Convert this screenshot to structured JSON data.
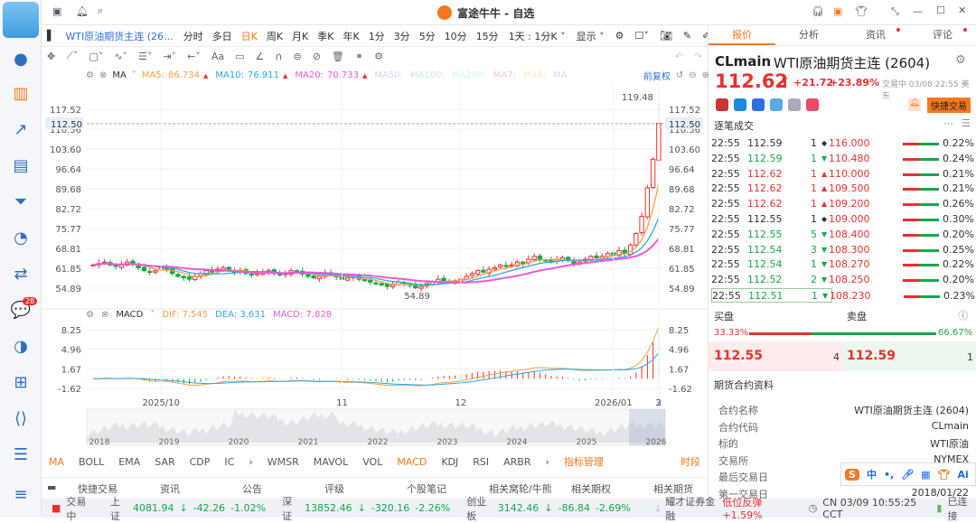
{
  "app": {
    "title": "富途牛牛 - 自选",
    "notification_badge": "28"
  },
  "toolbar": {
    "symbol": "WTI原油期货主连 (26...",
    "periods": [
      "分时",
      "多日",
      "日K",
      "周K",
      "月K",
      "季K",
      "年K",
      "1分",
      "3分",
      "5分",
      "10分",
      "15分"
    ],
    "active_period": "日K",
    "dropdown_15": "15分",
    "range": "1天 : 1分K",
    "display": "显示"
  },
  "ma": {
    "label": "MA",
    "items": [
      {
        "name": "MA5:",
        "value": "86.734",
        "color": "#f5a04a"
      },
      {
        "name": "MA10:",
        "value": "76.911",
        "color": "#2aa8e8"
      },
      {
        "name": "MA20:",
        "value": "70.733",
        "color": "#e85ad8"
      },
      {
        "name": "MA50:",
        "value": "",
        "color": "#c8d8f8"
      },
      {
        "name": "MA100:",
        "value": "",
        "color": "#c8ecd8"
      },
      {
        "name": "MA200:",
        "value": "",
        "color": "#c8f4f8"
      },
      {
        "name": "MA7:",
        "value": "",
        "color": "#f8c8c8"
      },
      {
        "name": "MA8:",
        "value": "",
        "color": "#f8e8c8"
      },
      {
        "name": "MA",
        "value": "",
        "color": "#e0d0f8"
      }
    ],
    "adjust": "前复权"
  },
  "macd": {
    "label": "MACD",
    "dif": "DIF: 7.545",
    "dea": "DEA: 3.631",
    "macd": "MACD: 7.828"
  },
  "chart_data": {
    "type": "candlestick",
    "price_ticks": [
      "117.52",
      "110.56",
      "103.60",
      "96.64",
      "89.68",
      "82.72",
      "75.77",
      "68.81",
      "61.85",
      "54.89"
    ],
    "last_price_label": "112.50",
    "high_label": "119.48",
    "low_label": "54.89",
    "macd_ticks": [
      "8.25",
      "4.96",
      "1.67",
      "-1.62"
    ],
    "x_labels": [
      "2025/10",
      "11",
      "12",
      "2026/01",
      "2",
      "3"
    ],
    "overview_years": [
      "2018",
      "2019",
      "2020",
      "2021",
      "2022",
      "2023",
      "2024",
      "2025",
      "2026"
    ],
    "closes": [
      63,
      63.5,
      64,
      63,
      62.5,
      63,
      64,
      63.5,
      62,
      61,
      60.5,
      61,
      62,
      61.5,
      60,
      59,
      58.5,
      58,
      59,
      60,
      61,
      60.5,
      61.5,
      62,
      61,
      60.5,
      61,
      60,
      59.5,
      60,
      60.5,
      61,
      60,
      59.5,
      60,
      61,
      60.5,
      59.8,
      59,
      58.5,
      59,
      60,
      59.5,
      58.8,
      58,
      58.5,
      59,
      58,
      57.5,
      57,
      56.5,
      56,
      55.5,
      56,
      57,
      56.5,
      55.8,
      55,
      55.5,
      56.5,
      57,
      58,
      57.5,
      57,
      57.5,
      58,
      59,
      60,
      61,
      60.5,
      61.5,
      62,
      63,
      62.5,
      63,
      64,
      63.5,
      65,
      66,
      65,
      64.5,
      64,
      65,
      65.5,
      64.5,
      63.5,
      64,
      65,
      66,
      65.5,
      66,
      67,
      66.5,
      68,
      67,
      70,
      74,
      80,
      90,
      100,
      112.62
    ]
  },
  "quote": {
    "tabs": [
      "报价",
      "分析",
      "资讯",
      "评论"
    ],
    "code": "CLmain",
    "name": "WTI原油期货主连 (2604)",
    "price": "112.62",
    "change": "+21.72",
    "pct": "+23.89%",
    "status": "交易中 03/08 22:55 美东",
    "quick_trade": "快捷交易",
    "ticks_title": "逐笔成交",
    "ticks": [
      [
        "22:55",
        "112.59",
        "1",
        "◆",
        "116.000",
        "0.22%"
      ],
      [
        "22:55",
        "112.59",
        "1",
        "▼",
        "110.480",
        "0.24%"
      ],
      [
        "22:55",
        "112.62",
        "1",
        "▲",
        "110.000",
        "0.21%"
      ],
      [
        "22:55",
        "112.62",
        "1",
        "▲",
        "109.500",
        "0.21%"
      ],
      [
        "22:55",
        "112.62",
        "1",
        "▲",
        "109.200",
        "0.26%"
      ],
      [
        "22:55",
        "112.55",
        "1",
        "◆",
        "109.000",
        "0.30%"
      ],
      [
        "22:55",
        "112.55",
        "5",
        "▼",
        "108.400",
        "0.20%"
      ],
      [
        "22:55",
        "112.54",
        "3",
        "▼",
        "108.300",
        "0.25%"
      ],
      [
        "22:55",
        "112.54",
        "1",
        "▼",
        "108.270",
        "0.22%"
      ],
      [
        "22:55",
        "112.52",
        "2",
        "▼",
        "108.250",
        "0.20%"
      ],
      [
        "22:55",
        "112.51",
        "1",
        "▼",
        "108.230",
        "0.23%"
      ]
    ],
    "bid_label": "买盘",
    "ask_label": "卖盘",
    "bid_pct": "33.33%",
    "ask_pct": "66.67%",
    "bid_ratio": 0.3333,
    "bid": "112.55",
    "bid_size": "4",
    "ask": "112.59",
    "ask_size": "1",
    "info_title": "期货合约资料",
    "info": [
      [
        "合约名称",
        "WTI原油期货主连 (2604)"
      ],
      [
        "合约代码",
        "CLmain"
      ],
      [
        "标的",
        "WTI原油"
      ],
      [
        "交易所",
        "NYMEX"
      ],
      [
        "最后交易日",
        ""
      ],
      [
        "第一交易日",
        "2018/01/22"
      ]
    ]
  },
  "indicators": {
    "main": [
      "MA",
      "BOLL",
      "EMA",
      "SAR",
      "CDP",
      "IC"
    ],
    "sub": [
      "WMSR",
      "MAVOL",
      "VOL",
      "MACD",
      "KDJ",
      "RSI",
      "ARBR"
    ],
    "manage": "指标管理",
    "period": "时段"
  },
  "bottom_tabs": [
    "快捷交易",
    "资讯",
    "公告",
    "评级",
    "个股笔记",
    "相关窝轮/牛熊",
    "相关期权",
    "相关期货"
  ],
  "status": {
    "trading": "交易中",
    "idx": [
      [
        "上证",
        "4081.94",
        "-42.26",
        "-1.02%"
      ],
      [
        "深证",
        "13852.46",
        "-320.16",
        "-2.26%"
      ],
      [
        "创业板",
        "3142.46",
        "-86.84",
        "-2.69%"
      ]
    ],
    "broker": "耀才证券金融",
    "news": "低位反弹 +1.59%",
    "clock": "CN 03/09 10:55:25 CCT",
    "conn": "已连接"
  },
  "ime": {
    "lang": "中",
    "ai": "Ai"
  }
}
